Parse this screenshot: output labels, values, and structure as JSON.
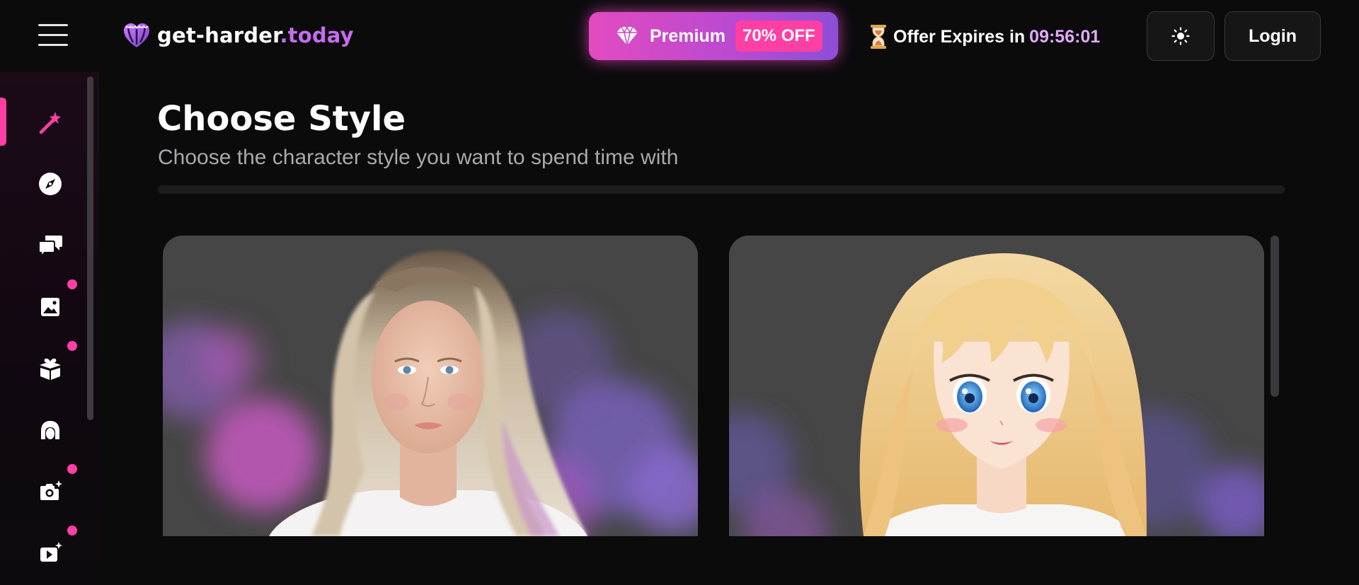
{
  "header": {
    "menu_icon": "hamburger-menu-icon",
    "logo": {
      "name": "get-harder",
      "tld": ".today",
      "icon": "heart-logo-icon"
    },
    "premium": {
      "label": "Premium",
      "discount": "70% OFF",
      "icon": "diamond-icon"
    },
    "offer": {
      "label": "Offer Expires in",
      "time": "09:56:01",
      "icon": "hourglass-icon"
    },
    "theme_icon": "sun-icon",
    "login_label": "Login"
  },
  "sidebar": {
    "items": [
      {
        "icon": "magic-wand-icon",
        "active": true,
        "dot": false
      },
      {
        "icon": "compass-icon",
        "active": false,
        "dot": false
      },
      {
        "icon": "chat-bubbles-icon",
        "active": false,
        "dot": false
      },
      {
        "icon": "image-icon",
        "active": false,
        "dot": true
      },
      {
        "icon": "gift-box-icon",
        "active": false,
        "dot": true
      },
      {
        "icon": "hair-profile-icon",
        "active": false,
        "dot": false
      },
      {
        "icon": "camera-sparkle-icon",
        "active": false,
        "dot": true
      },
      {
        "icon": "video-sparkle-icon",
        "active": false,
        "dot": true
      }
    ]
  },
  "main": {
    "title": "Choose Style",
    "subtitle": "Choose the character style you want to spend time with",
    "styles": [
      {
        "type": "realistic-portrait"
      },
      {
        "type": "anime-portrait"
      }
    ]
  },
  "colors": {
    "accent": "#ff3fa4",
    "brand_purple": "#c56cf0",
    "timer": "#e3a8ff",
    "background": "#0b0b0c"
  }
}
